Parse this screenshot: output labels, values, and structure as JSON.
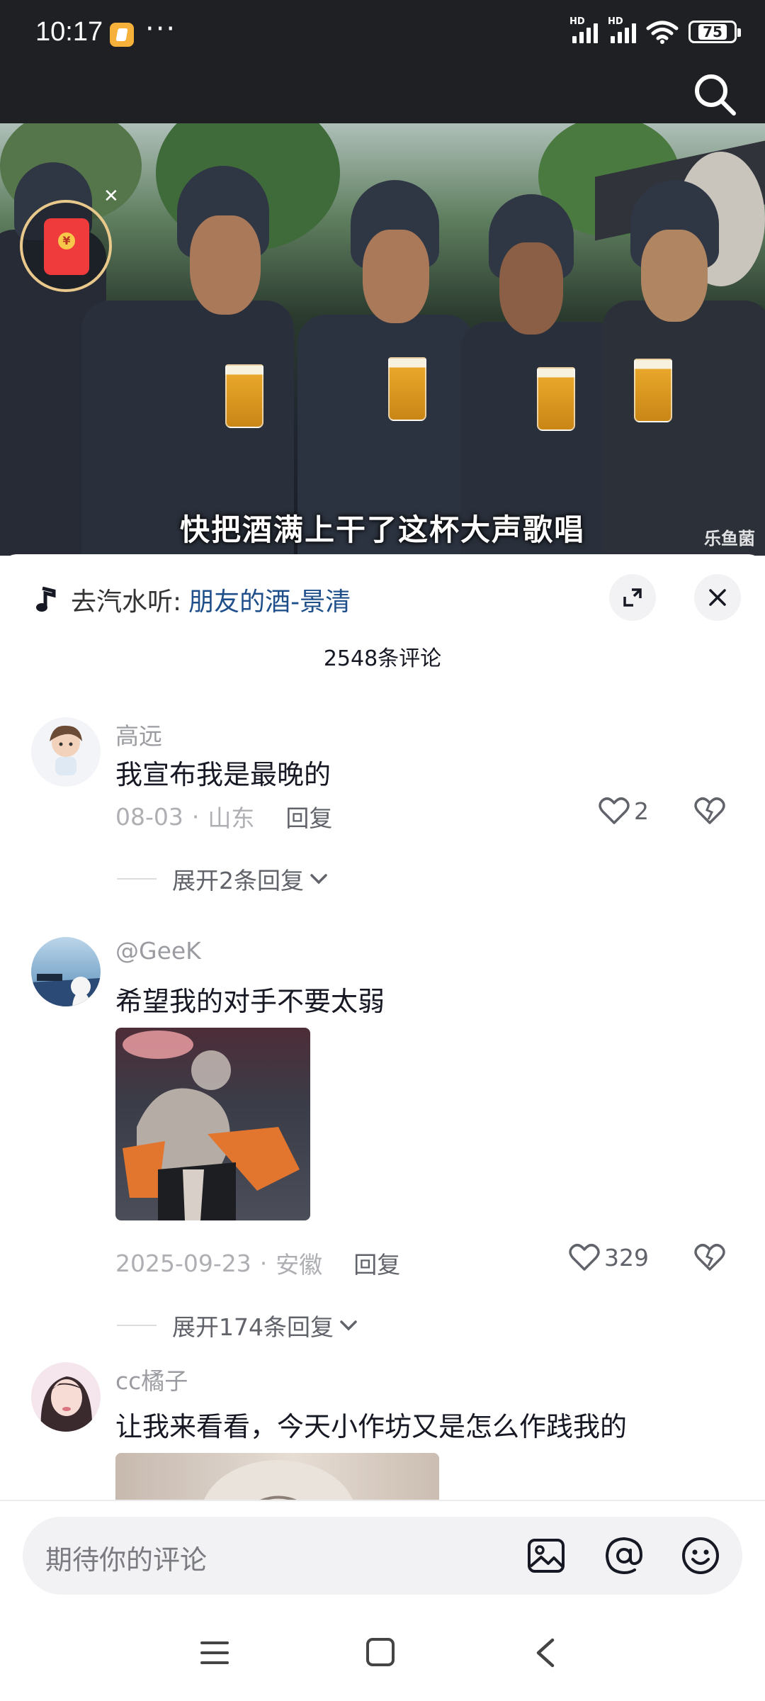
{
  "status_bar": {
    "time": "10:17",
    "more": "···",
    "signal1": "HD",
    "signal2": "HD",
    "battery": "75"
  },
  "video": {
    "subtitle": "快把酒满上干了这杯大声歌唱",
    "watermark": "乐鱼菌"
  },
  "sheet": {
    "music_prefix": "去汽水听:",
    "music_song": "朋友的酒-景清",
    "comment_count": "2548条评论"
  },
  "comments": [
    {
      "username": "高远",
      "text": "我宣布我是最晚的",
      "date": "08-03",
      "location": "山东",
      "reply": "回复",
      "likes": "2",
      "expand": "展开2条回复"
    },
    {
      "username": "@GeeK",
      "text": "希望我的对手不要太弱",
      "date": "2025-09-23",
      "location": "安徽",
      "reply": "回复",
      "likes": "329",
      "expand": "展开174条回复"
    },
    {
      "username": "cc橘子",
      "text": "让我来看看，今天小作坊又是怎么作践我的"
    }
  ],
  "input": {
    "placeholder": "期待你的评论"
  },
  "meta_sep": "·",
  "colors": {
    "link_blue": "#1e4f8a",
    "muted": "#9b9ca1",
    "redpacket": "#ef3b3b"
  },
  "icons": [
    "search-icon",
    "music-note-icon",
    "expand-icon",
    "close-icon",
    "heart-icon",
    "dislike-heart-icon",
    "chevron-down-icon",
    "image-icon",
    "at-icon",
    "emoji-icon",
    "menu-icon",
    "home-icon",
    "back-icon",
    "redpacket-icon"
  ]
}
